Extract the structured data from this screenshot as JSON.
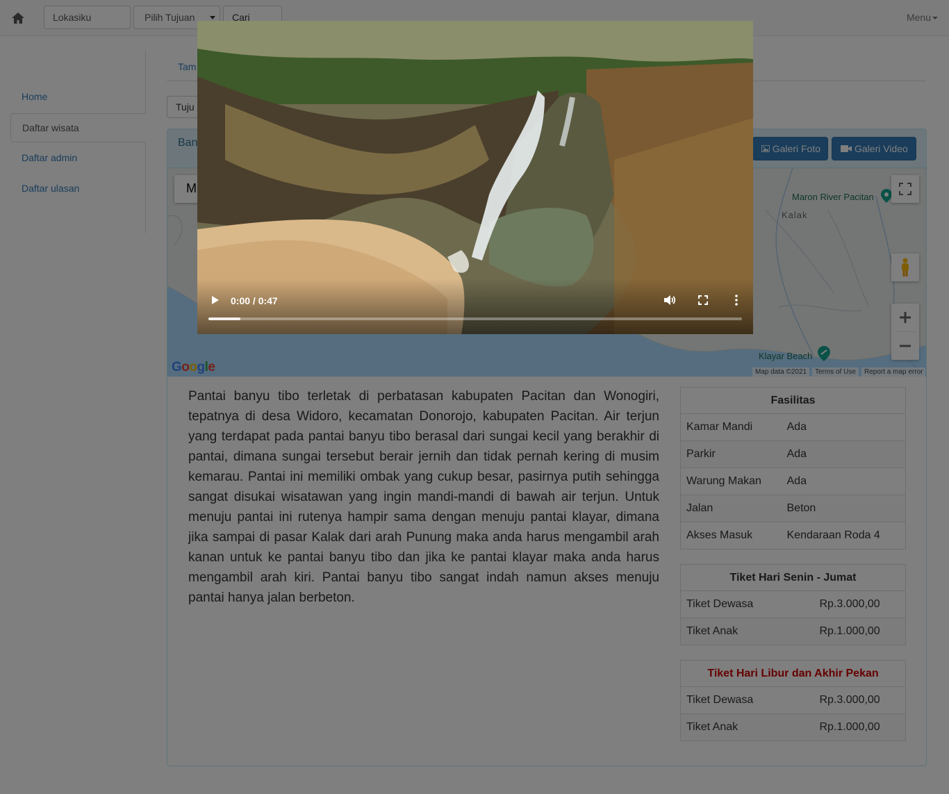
{
  "navbar": {
    "home_icon": "home-icon",
    "location_value": "Lokasiku",
    "destination_select": "Pilih Tujuan",
    "route_button": "Cari Rute",
    "menu_label": "Menu"
  },
  "sidebar": {
    "items": [
      {
        "label": "Home"
      },
      {
        "label": "Daftar wisata"
      },
      {
        "label": "Daftar admin"
      },
      {
        "label": "Daftar ulasan"
      }
    ]
  },
  "main": {
    "tab_label": "Tam",
    "tujuan_select": "Tuju",
    "panel_title": "Ban",
    "gallery_photo": "Galeri Foto",
    "gallery_video": "Galeri Video"
  },
  "map": {
    "map_type_label": "M",
    "labels": {
      "maron": "Maron River Pacitan",
      "kalak": "Kalak",
      "klayar": "Klayar Beach"
    },
    "google": "Google",
    "map_data": "Map data ©2021",
    "terms": "Terms of Use",
    "report": "Report a map error"
  },
  "description": "Pantai banyu tibo terletak di perbatasan kabupaten Pacitan dan Wonogiri, tepatnya di desa Widoro, kecamatan Donorojo, kabupaten Pacitan. Air terjun yang terdapat pada pantai banyu tibo berasal dari sungai kecil yang berakhir di pantai, dimana sungai tersebut berair jernih dan tidak pernah kering di musim kemarau. Pantai ini memiliki ombak yang cukup besar, pasirnya putih sehingga sangat disukai wisatawan yang ingin mandi-mandi di bawah air terjun. Untuk menuju pantai ini rutenya hampir sama dengan menuju pantai klayar, dimana jika sampai di pasar Kalak dari arah Punung maka anda harus mengambil arah kanan untuk ke pantai banyu tibo dan jika ke pantai klayar maka anda harus mengambil arah kiri. Pantai banyu tibo sangat indah namun akses menuju pantai hanya jalan berbeton.",
  "facilities": {
    "title": "Fasilitas",
    "rows": [
      {
        "name": "Kamar Mandi",
        "value": "Ada"
      },
      {
        "name": "Parkir",
        "value": "Ada"
      },
      {
        "name": "Warung Makan",
        "value": "Ada"
      },
      {
        "name": "Jalan",
        "value": "Beton"
      },
      {
        "name": "Akses Masuk",
        "value": "Kendaraan Roda 4"
      }
    ]
  },
  "weekday_tickets": {
    "title": "Tiket Hari Senin - Jumat",
    "rows": [
      {
        "name": "Tiket Dewasa",
        "value": "Rp.3.000,00"
      },
      {
        "name": "Tiket Anak",
        "value": "Rp.1.000,00"
      }
    ]
  },
  "weekend_tickets": {
    "title": "Tiket Hari Libur dan Akhir Pekan",
    "title_color": "#cc0000",
    "rows": [
      {
        "name": "Tiket Dewasa",
        "value": "Rp.3.000,00"
      },
      {
        "name": "Tiket Anak",
        "value": "Rp.1.000,00"
      }
    ]
  },
  "video": {
    "time": "0:00 / 0:47",
    "progress_fraction": 0.06,
    "play_icon": "play-icon",
    "volume_icon": "volume-icon",
    "fullscreen_icon": "fullscreen-icon",
    "more_icon": "more-options-icon"
  },
  "colors": {
    "primary": "#337ab7",
    "panel_head": "#d9edf7",
    "overlay": "rgba(0,0,0,0.5)"
  }
}
